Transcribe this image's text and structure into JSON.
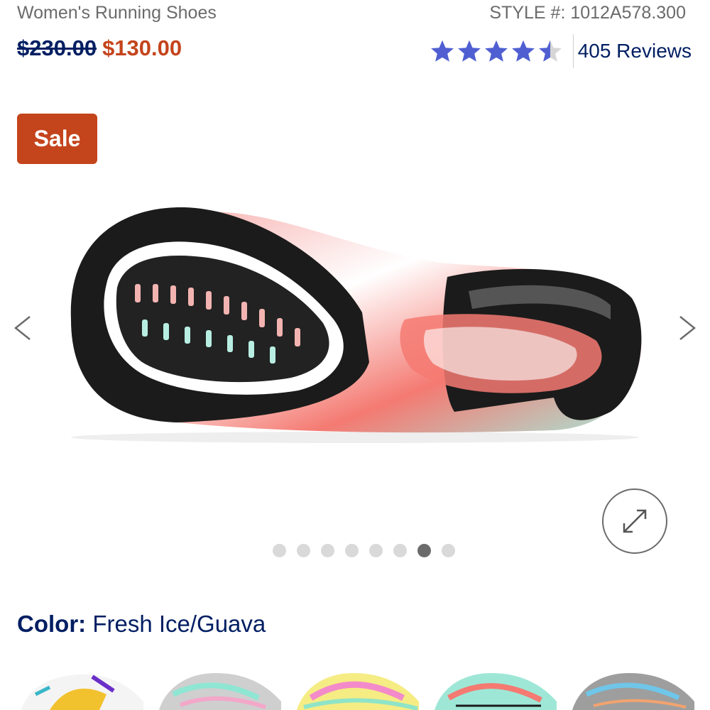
{
  "product": {
    "category": "Women's Running Shoes",
    "style_number": "STYLE #: 1012A578.300"
  },
  "price": {
    "original": "$230.00",
    "sale": "$130.00"
  },
  "rating": {
    "stars": 4.5,
    "max_stars": 5,
    "star_color": "#4f5fd1",
    "reviews_label": "405 Reviews"
  },
  "badge": {
    "label": "Sale",
    "color": "#c4441c"
  },
  "gallery": {
    "image_count": 8,
    "active_index": 6,
    "prev_icon": "chevron-left-icon",
    "next_icon": "chevron-right-icon",
    "expand_icon": "expand-icon"
  },
  "color": {
    "label": "Color:",
    "value": "Fresh Ice/Guava"
  },
  "swatches": [
    {
      "name": "white-purple-yellow"
    },
    {
      "name": "grey-mint-pink"
    },
    {
      "name": "yellow-pink-mint"
    },
    {
      "name": "mint-guava"
    },
    {
      "name": "grey-blue"
    }
  ]
}
